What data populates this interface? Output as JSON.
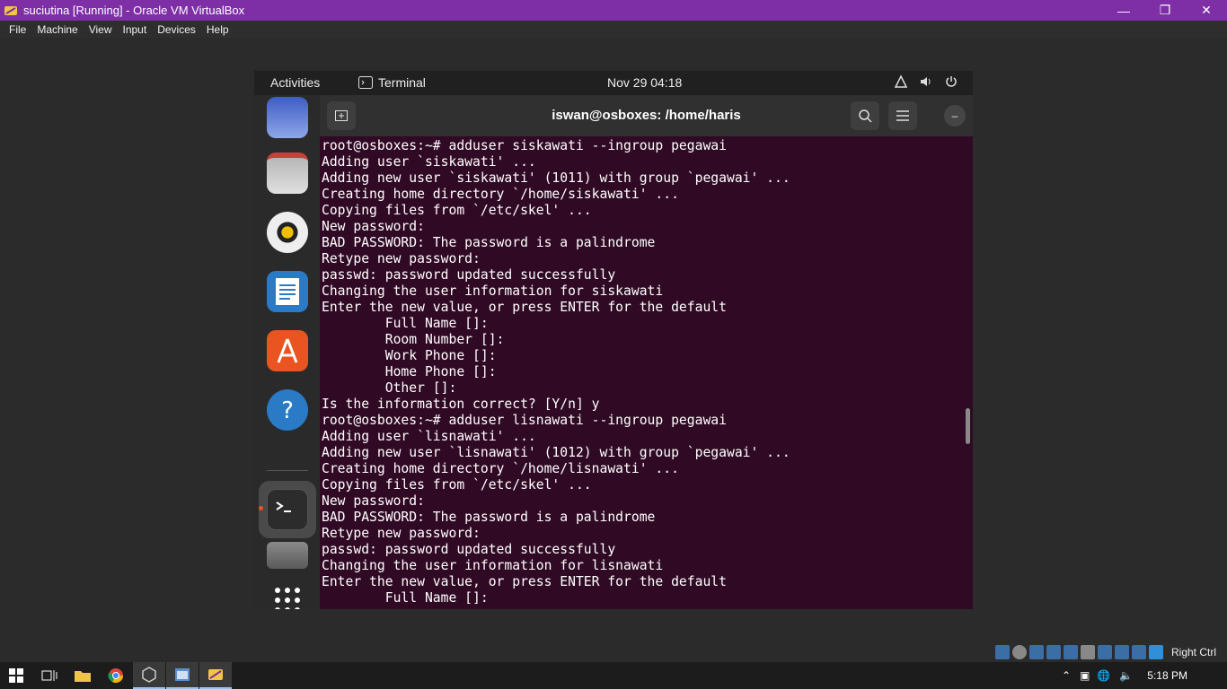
{
  "vbox": {
    "title": "suciutina [Running] - Oracle VM VirtualBox",
    "menu": [
      "File",
      "Machine",
      "View",
      "Input",
      "Devices",
      "Help"
    ],
    "host_key": "Right Ctrl"
  },
  "gnome": {
    "activities": "Activities",
    "app_name": "Terminal",
    "clock": "Nov 29  04:18"
  },
  "terminal": {
    "title": "iswan@osboxes: /home/haris",
    "lines": [
      "root@osboxes:~# adduser siskawati --ingroup pegawai",
      "Adding user `siskawati' ...",
      "Adding new user `siskawati' (1011) with group `pegawai' ...",
      "Creating home directory `/home/siskawati' ...",
      "Copying files from `/etc/skel' ...",
      "New password:",
      "BAD PASSWORD: The password is a palindrome",
      "Retype new password:",
      "passwd: password updated successfully",
      "Changing the user information for siskawati",
      "Enter the new value, or press ENTER for the default",
      "        Full Name []:",
      "        Room Number []:",
      "        Work Phone []:",
      "        Home Phone []:",
      "        Other []:",
      "Is the information correct? [Y/n] y",
      "root@osboxes:~# adduser lisnawati --ingroup pegawai",
      "Adding user `lisnawati' ...",
      "Adding new user `lisnawati' (1012) with group `pegawai' ...",
      "Creating home directory `/home/lisnawati' ...",
      "Copying files from `/etc/skel' ...",
      "New password:",
      "BAD PASSWORD: The password is a palindrome",
      "Retype new password:",
      "passwd: password updated successfully",
      "Changing the user information for lisnawati",
      "Enter the new value, or press ENTER for the default",
      "        Full Name []:"
    ]
  },
  "taskbar": {
    "time": "5:18 PM"
  }
}
